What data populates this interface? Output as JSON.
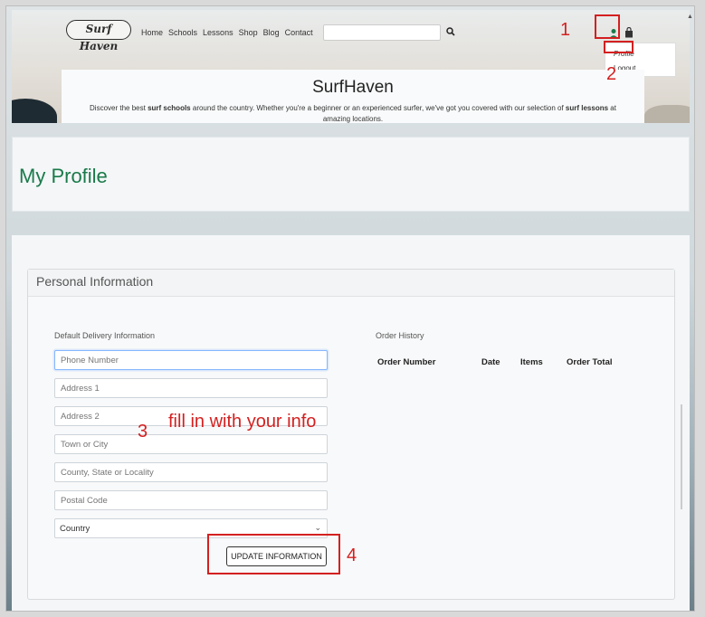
{
  "brand": {
    "logo_text": "Surf Haven"
  },
  "nav": {
    "items": [
      "Home",
      "Schools",
      "Lessons",
      "Shop",
      "Blog",
      "Contact"
    ]
  },
  "search": {
    "placeholder": ""
  },
  "account_menu": {
    "profile": "Profile",
    "logout": "Logout"
  },
  "banner": {
    "title": "SurfHaven",
    "tagline_parts": [
      "Discover the best ",
      "surf schools",
      " around the country. Whether you're a beginner or an experienced surfer, we've got you covered with our selection of ",
      "surf lessons",
      " at amazing locations."
    ]
  },
  "page": {
    "title": "My Profile"
  },
  "card": {
    "title": "Personal Information"
  },
  "delivery": {
    "label": "Default Delivery Information",
    "fields": [
      {
        "placeholder": "Phone Number"
      },
      {
        "placeholder": "Address 1"
      },
      {
        "placeholder": "Address 2"
      },
      {
        "placeholder": "Town or City"
      },
      {
        "placeholder": "County, State or Locality"
      },
      {
        "placeholder": "Postal Code"
      }
    ],
    "country": "Country",
    "update_label": "UPDATE INFORMATION"
  },
  "orders": {
    "label": "Order History",
    "columns": [
      "Order Number",
      "Date",
      "Items",
      "Order Total"
    ]
  },
  "annotations": {
    "step1": "1",
    "step2": "2",
    "step3": "3",
    "step3_text": "fill in with your info",
    "step4": "4"
  },
  "colors": {
    "accent_green": "#1a7a4a",
    "annotation_red": "#d42020"
  }
}
